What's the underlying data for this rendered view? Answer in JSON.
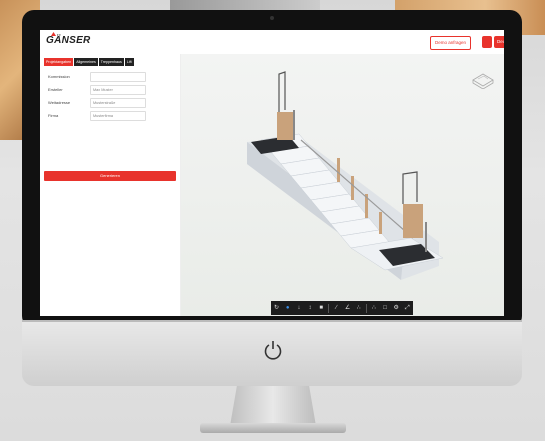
{
  "app": {
    "logo_text": "GÄNSER",
    "demo_button_label": "Demo anfragen",
    "language_label": "Deutsch ∨"
  },
  "tabs": [
    {
      "label": "Projektangaben",
      "active": true
    },
    {
      "label": "Allgemeines",
      "active": false
    },
    {
      "label": "Treppenhaus",
      "active": false
    },
    {
      "label": "Lift",
      "active": false
    }
  ],
  "form": {
    "fields": [
      {
        "label": "Kommission",
        "value": ""
      },
      {
        "label": "Ersteller",
        "value": "Max Muster"
      },
      {
        "label": "Weitadresse",
        "value": "Musterstraße"
      },
      {
        "label": "Firma",
        "value": "Musterfirma"
      }
    ],
    "generate_label": "Generieren"
  },
  "toolbar": {
    "icons": [
      "rotate-icon",
      "circle-dot-icon",
      "down-arrow-icon",
      "up-down-icon",
      "camera-icon",
      "separator",
      "pen-icon",
      "angle-icon",
      "nodes-icon",
      "separator",
      "graph-icon",
      "trash-icon",
      "settings-icon",
      "expand-icon"
    ]
  },
  "colors": {
    "accent": "#e8332c",
    "toolbar": "#1d1d1d",
    "stair": "#f4f6f8",
    "platform": "#2b2d31",
    "rail": "#c9a27b"
  }
}
